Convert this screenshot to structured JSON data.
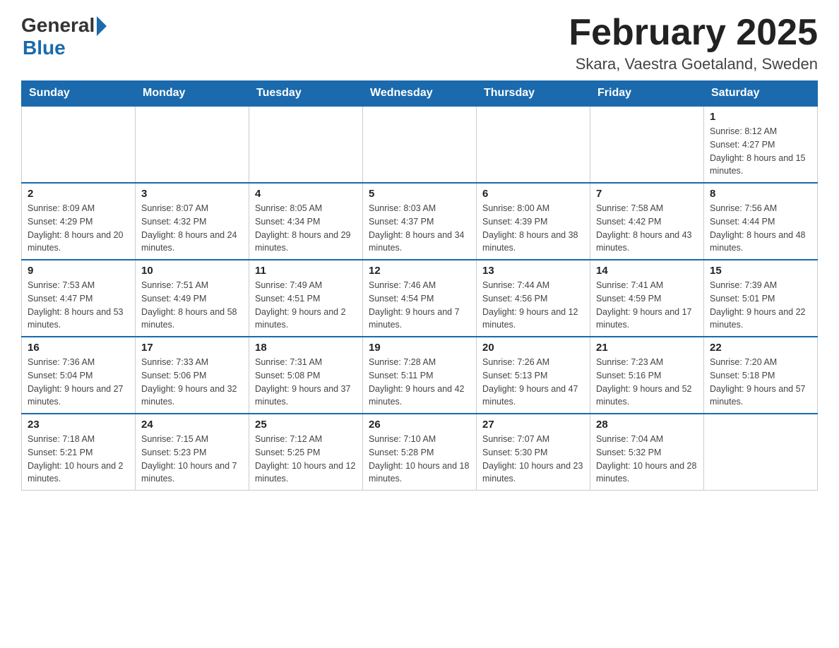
{
  "logo": {
    "general": "General",
    "blue": "Blue"
  },
  "title": "February 2025",
  "location": "Skara, Vaestra Goetaland, Sweden",
  "days_of_week": [
    "Sunday",
    "Monday",
    "Tuesday",
    "Wednesday",
    "Thursday",
    "Friday",
    "Saturday"
  ],
  "weeks": [
    [
      {
        "day": "",
        "info": ""
      },
      {
        "day": "",
        "info": ""
      },
      {
        "day": "",
        "info": ""
      },
      {
        "day": "",
        "info": ""
      },
      {
        "day": "",
        "info": ""
      },
      {
        "day": "",
        "info": ""
      },
      {
        "day": "1",
        "info": "Sunrise: 8:12 AM\nSunset: 4:27 PM\nDaylight: 8 hours and 15 minutes."
      }
    ],
    [
      {
        "day": "2",
        "info": "Sunrise: 8:09 AM\nSunset: 4:29 PM\nDaylight: 8 hours and 20 minutes."
      },
      {
        "day": "3",
        "info": "Sunrise: 8:07 AM\nSunset: 4:32 PM\nDaylight: 8 hours and 24 minutes."
      },
      {
        "day": "4",
        "info": "Sunrise: 8:05 AM\nSunset: 4:34 PM\nDaylight: 8 hours and 29 minutes."
      },
      {
        "day": "5",
        "info": "Sunrise: 8:03 AM\nSunset: 4:37 PM\nDaylight: 8 hours and 34 minutes."
      },
      {
        "day": "6",
        "info": "Sunrise: 8:00 AM\nSunset: 4:39 PM\nDaylight: 8 hours and 38 minutes."
      },
      {
        "day": "7",
        "info": "Sunrise: 7:58 AM\nSunset: 4:42 PM\nDaylight: 8 hours and 43 minutes."
      },
      {
        "day": "8",
        "info": "Sunrise: 7:56 AM\nSunset: 4:44 PM\nDaylight: 8 hours and 48 minutes."
      }
    ],
    [
      {
        "day": "9",
        "info": "Sunrise: 7:53 AM\nSunset: 4:47 PM\nDaylight: 8 hours and 53 minutes."
      },
      {
        "day": "10",
        "info": "Sunrise: 7:51 AM\nSunset: 4:49 PM\nDaylight: 8 hours and 58 minutes."
      },
      {
        "day": "11",
        "info": "Sunrise: 7:49 AM\nSunset: 4:51 PM\nDaylight: 9 hours and 2 minutes."
      },
      {
        "day": "12",
        "info": "Sunrise: 7:46 AM\nSunset: 4:54 PM\nDaylight: 9 hours and 7 minutes."
      },
      {
        "day": "13",
        "info": "Sunrise: 7:44 AM\nSunset: 4:56 PM\nDaylight: 9 hours and 12 minutes."
      },
      {
        "day": "14",
        "info": "Sunrise: 7:41 AM\nSunset: 4:59 PM\nDaylight: 9 hours and 17 minutes."
      },
      {
        "day": "15",
        "info": "Sunrise: 7:39 AM\nSunset: 5:01 PM\nDaylight: 9 hours and 22 minutes."
      }
    ],
    [
      {
        "day": "16",
        "info": "Sunrise: 7:36 AM\nSunset: 5:04 PM\nDaylight: 9 hours and 27 minutes."
      },
      {
        "day": "17",
        "info": "Sunrise: 7:33 AM\nSunset: 5:06 PM\nDaylight: 9 hours and 32 minutes."
      },
      {
        "day": "18",
        "info": "Sunrise: 7:31 AM\nSunset: 5:08 PM\nDaylight: 9 hours and 37 minutes."
      },
      {
        "day": "19",
        "info": "Sunrise: 7:28 AM\nSunset: 5:11 PM\nDaylight: 9 hours and 42 minutes."
      },
      {
        "day": "20",
        "info": "Sunrise: 7:26 AM\nSunset: 5:13 PM\nDaylight: 9 hours and 47 minutes."
      },
      {
        "day": "21",
        "info": "Sunrise: 7:23 AM\nSunset: 5:16 PM\nDaylight: 9 hours and 52 minutes."
      },
      {
        "day": "22",
        "info": "Sunrise: 7:20 AM\nSunset: 5:18 PM\nDaylight: 9 hours and 57 minutes."
      }
    ],
    [
      {
        "day": "23",
        "info": "Sunrise: 7:18 AM\nSunset: 5:21 PM\nDaylight: 10 hours and 2 minutes."
      },
      {
        "day": "24",
        "info": "Sunrise: 7:15 AM\nSunset: 5:23 PM\nDaylight: 10 hours and 7 minutes."
      },
      {
        "day": "25",
        "info": "Sunrise: 7:12 AM\nSunset: 5:25 PM\nDaylight: 10 hours and 12 minutes."
      },
      {
        "day": "26",
        "info": "Sunrise: 7:10 AM\nSunset: 5:28 PM\nDaylight: 10 hours and 18 minutes."
      },
      {
        "day": "27",
        "info": "Sunrise: 7:07 AM\nSunset: 5:30 PM\nDaylight: 10 hours and 23 minutes."
      },
      {
        "day": "28",
        "info": "Sunrise: 7:04 AM\nSunset: 5:32 PM\nDaylight: 10 hours and 28 minutes."
      },
      {
        "day": "",
        "info": ""
      }
    ]
  ]
}
